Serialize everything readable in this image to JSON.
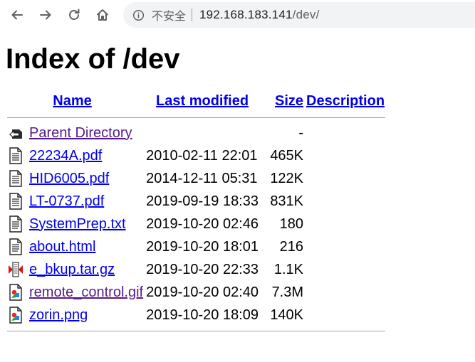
{
  "browser": {
    "back_icon": "arrow-left-icon",
    "forward_icon": "arrow-right-icon",
    "reload_icon": "reload-icon",
    "home_icon": "home-icon",
    "security_icon": "info-circle-icon",
    "security_label": "不安全",
    "url_host": "192.168.183.141",
    "url_path": "/dev/"
  },
  "page": {
    "title": "Index of /dev"
  },
  "table": {
    "headers": {
      "name": "Name",
      "last_modified": "Last modified",
      "size": "Size",
      "description": "Description"
    },
    "parent": {
      "label": "Parent Directory",
      "size": "-",
      "icon": "back-folder-icon"
    },
    "rows": [
      {
        "name": "22234A.pdf",
        "modified": "2010-02-11 22:01",
        "size": "465K",
        "icon": "file-icon"
      },
      {
        "name": "HID6005.pdf",
        "modified": "2014-12-11 05:31",
        "size": "122K",
        "icon": "file-icon"
      },
      {
        "name": "LT-0737.pdf",
        "modified": "2019-09-19 18:33",
        "size": "831K",
        "icon": "file-icon"
      },
      {
        "name": "SystemPrep.txt",
        "modified": "2019-10-20 02:46",
        "size": "180",
        "icon": "text-file-icon"
      },
      {
        "name": "about.html",
        "modified": "2019-10-20 18:01",
        "size": "216",
        "icon": "text-file-icon"
      },
      {
        "name": "e_bkup.tar.gz",
        "modified": "2019-10-20 22:33",
        "size": "1.1K",
        "icon": "archive-icon"
      },
      {
        "name": "remote_control.gif",
        "modified": "2019-10-20 02:40",
        "size": "7.3M",
        "icon": "image-file-icon"
      },
      {
        "name": "zorin.png",
        "modified": "2019-10-20 18:09",
        "size": "140K",
        "icon": "image-file-icon"
      }
    ]
  }
}
